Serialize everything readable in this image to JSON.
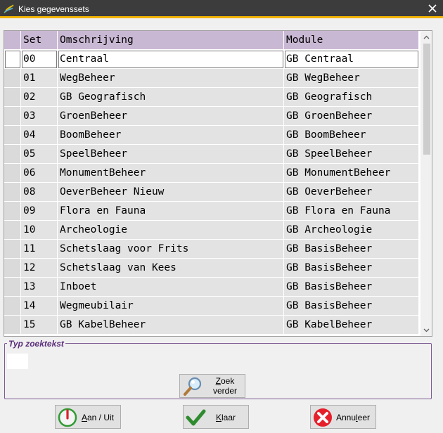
{
  "window": {
    "title": "Kies gegevenssets"
  },
  "grid": {
    "columns": [
      "Set",
      "Omschrijving",
      "Module"
    ],
    "selected_index": 0,
    "rows": [
      {
        "set": "00",
        "desc": "Centraal",
        "module": "GB Centraal"
      },
      {
        "set": "01",
        "desc": "WegBeheer",
        "module": "GB WegBeheer"
      },
      {
        "set": "02",
        "desc": "GB Geografisch",
        "module": "GB Geografisch"
      },
      {
        "set": "03",
        "desc": "GroenBeheer",
        "module": "GB GroenBeheer"
      },
      {
        "set": "04",
        "desc": "BoomBeheer",
        "module": "GB BoomBeheer"
      },
      {
        "set": "05",
        "desc": "SpeelBeheer",
        "module": "GB SpeelBeheer"
      },
      {
        "set": "06",
        "desc": "MonumentBeheer",
        "module": "GB MonumentBeheer"
      },
      {
        "set": "08",
        "desc": "OeverBeheer Nieuw",
        "module": "GB OeverBeheer"
      },
      {
        "set": "09",
        "desc": "Flora en Fauna",
        "module": "GB Flora en Fauna"
      },
      {
        "set": "10",
        "desc": "Archeologie",
        "module": "GB Archeologie"
      },
      {
        "set": "11",
        "desc": "Schetslaag voor Frits",
        "module": "GB BasisBeheer"
      },
      {
        "set": "12",
        "desc": "Schetslaag van Kees",
        "module": "GB BasisBeheer"
      },
      {
        "set": "13",
        "desc": "Inboet",
        "module": "GB BasisBeheer"
      },
      {
        "set": "14",
        "desc": "Wegmeubilair",
        "module": "GB BasisBeheer"
      },
      {
        "set": "15",
        "desc": "GB KabelBeheer",
        "module": "GB KabelBeheer"
      }
    ]
  },
  "search": {
    "legend": "Typ zoektekst",
    "value": "",
    "button_line1_first": "Z",
    "button_line1_rest": "oek",
    "button_line2": "verder"
  },
  "buttons": {
    "power": {
      "mnemonic": "A",
      "rest": "an / Uit"
    },
    "ok": {
      "mnemonic": "K",
      "rest": "laar"
    },
    "cancel": {
      "pre": "Annu",
      "mnemonic": "l",
      "rest": "eer"
    }
  },
  "colors": {
    "titlebar": "#3c3c3c",
    "titlebar_accent": "#f2b400",
    "header_bg": "#c9b8d3",
    "row_bg": "#e3e3e3",
    "group_border": "#7c5a93",
    "legend_text": "#5a2d7a"
  },
  "icons": {
    "app": "app-leaves-icon",
    "close": "close-icon",
    "search": "magnifier-icon",
    "power": "power-icon",
    "ok": "checkmark-icon",
    "cancel": "cancel-x-icon"
  }
}
